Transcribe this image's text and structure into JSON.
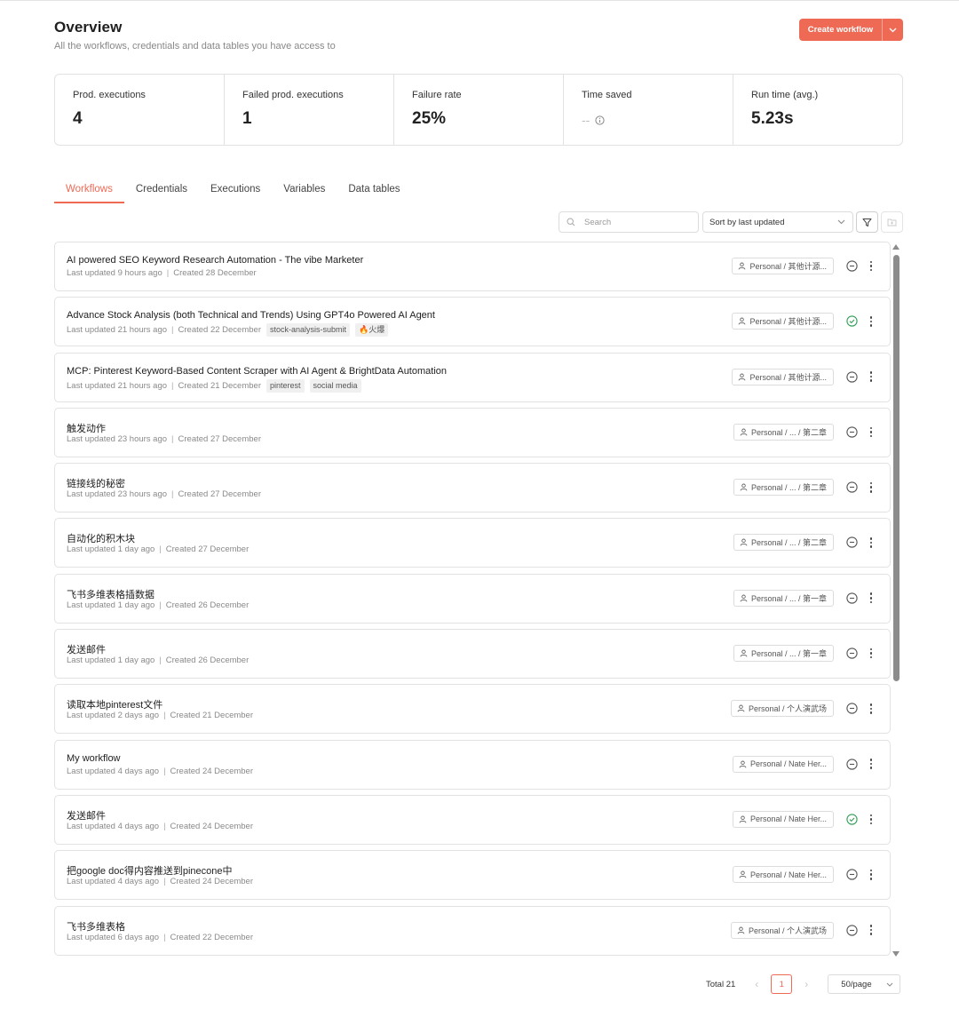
{
  "header": {
    "title": "Overview",
    "subtitle": "All the workflows, credentials and data tables you have access to",
    "create_label": "Create workflow"
  },
  "stats": [
    {
      "label": "Prod. executions",
      "value": "4"
    },
    {
      "label": "Failed prod. executions",
      "value": "1"
    },
    {
      "label": "Failure rate",
      "value": "25%"
    },
    {
      "label": "Time saved",
      "value": "--"
    },
    {
      "label": "Run time (avg.)",
      "value": "5.23s"
    }
  ],
  "tabs": [
    "Workflows",
    "Credentials",
    "Executions",
    "Variables",
    "Data tables"
  ],
  "active_tab": "Workflows",
  "toolbar": {
    "search_placeholder": "Search",
    "sort_label": "Sort by last updated"
  },
  "workflows": [
    {
      "name": "AI powered SEO Keyword Research Automation - The vibe Marketer",
      "updated": "Last updated 9 hours ago",
      "created": "Created 28 December",
      "tags": [],
      "owner": "Personal / 其他计源...",
      "status": "inactive"
    },
    {
      "name": "Advance Stock Analysis (both Technical and Trends) Using GPT4o Powered AI Agent",
      "updated": "Last updated 21 hours ago",
      "created": "Created 22 December",
      "tags": [
        "stock-analysis-submit",
        "🔥火爆"
      ],
      "owner": "Personal / 其他计源...",
      "status": "active"
    },
    {
      "name": "MCP: Pinterest Keyword-Based Content Scraper with AI Agent & BrightData Automation",
      "updated": "Last updated 21 hours ago",
      "created": "Created 21 December",
      "tags": [
        "pinterest",
        "social media"
      ],
      "owner": "Personal / 其他计源...",
      "status": "inactive"
    },
    {
      "name": "触发动作",
      "updated": "Last updated 23 hours ago",
      "created": "Created 27 December",
      "tags": [],
      "owner": "Personal / ... / 第二章",
      "status": "inactive"
    },
    {
      "name": "链接线的秘密",
      "updated": "Last updated 23 hours ago",
      "created": "Created 27 December",
      "tags": [],
      "owner": "Personal / ... / 第二章",
      "status": "inactive"
    },
    {
      "name": "自动化的积木块",
      "updated": "Last updated 1 day ago",
      "created": "Created 27 December",
      "tags": [],
      "owner": "Personal / ... / 第二章",
      "status": "inactive"
    },
    {
      "name": "飞书多维表格插数据",
      "updated": "Last updated 1 day ago",
      "created": "Created 26 December",
      "tags": [],
      "owner": "Personal / ... / 第一章",
      "status": "inactive"
    },
    {
      "name": "发送邮件",
      "updated": "Last updated 1 day ago",
      "created": "Created 26 December",
      "tags": [],
      "owner": "Personal / ... / 第一章",
      "status": "inactive"
    },
    {
      "name": "读取本地pinterest文件",
      "updated": "Last updated 2 days ago",
      "created": "Created 21 December",
      "tags": [],
      "owner": "Personal / 个人演武场",
      "status": "inactive"
    },
    {
      "name": "My workflow",
      "updated": "Last updated 4 days ago",
      "created": "Created 24 December",
      "tags": [],
      "owner": "Personal / Nate Her...",
      "status": "inactive"
    },
    {
      "name": "发送邮件",
      "updated": "Last updated 4 days ago",
      "created": "Created 24 December",
      "tags": [],
      "owner": "Personal / Nate Her...",
      "status": "active"
    },
    {
      "name": "把google doc得内容推送到pinecone中",
      "updated": "Last updated 4 days ago",
      "created": "Created 24 December",
      "tags": [],
      "owner": "Personal / Nate Her...",
      "status": "inactive"
    },
    {
      "name": "飞书多维表格",
      "updated": "Last updated 6 days ago",
      "created": "Created 22 December",
      "tags": [],
      "owner": "Personal / 个人演武场",
      "status": "inactive"
    }
  ],
  "pagination": {
    "total": "Total 21",
    "current": "1",
    "page_size": "50/page"
  },
  "colors": {
    "accent": "#ee6a55",
    "active_status": "#2f9e55",
    "inactive_status": "#555555"
  }
}
